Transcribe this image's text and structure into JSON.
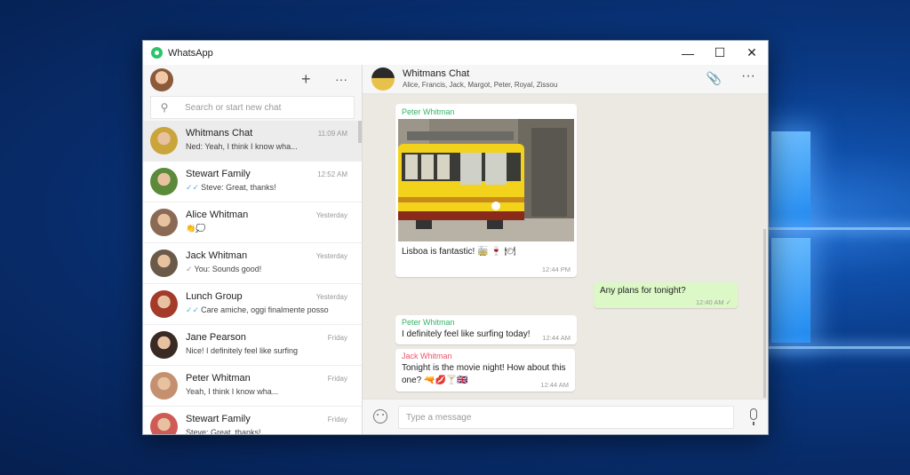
{
  "window": {
    "title": "WhatsApp",
    "controls": [
      "—",
      "☐",
      "✕"
    ]
  },
  "left": {
    "add_icon": "+",
    "more_icon": "···",
    "search_placeholder": "Search or start new chat",
    "chats": [
      {
        "name": "Whitmans Chat",
        "time": "11:09 AM",
        "message": "Ned: Yeah, I think I know wha...",
        "tick": "",
        "avatar_color": "#c9a53c",
        "selected": true
      },
      {
        "name": "Stewart Family",
        "time": "12:52 AM",
        "message": "Steve: Great, thanks!",
        "tick": "✓✓",
        "avatar_color": "#5a8a3a"
      },
      {
        "name": "Alice Whitman",
        "time": "Yesterday",
        "message": "👏💭",
        "tick": "",
        "avatar_color": "#8b6a55"
      },
      {
        "name": "Jack Whitman",
        "time": "Yesterday",
        "message": "You: Sounds good!",
        "tick": "✓",
        "avatar_color": "#6b5a4a"
      },
      {
        "name": "Lunch Group",
        "time": "Yesterday",
        "message": "Care amiche, oggi finalmente posso",
        "tick": "✓✓",
        "avatar_color": "#a33a2a"
      },
      {
        "name": "Jane Pearson",
        "time": "Friday",
        "message": "Nice! I definitely feel like surfing",
        "tick": "",
        "avatar_color": "#3a2a24"
      },
      {
        "name": "Peter Whitman",
        "time": "Friday",
        "message": "Yeah, I think I know wha...",
        "tick": "",
        "avatar_color": "#c49070"
      },
      {
        "name": "Stewart Family",
        "time": "Friday",
        "message": "Steve: Great, thanks!",
        "tick": "",
        "avatar_color": "#d05a55"
      }
    ]
  },
  "right": {
    "group_name": "Whitmans Chat",
    "members": "Alice, Francis, Jack, Margot, Peter, Royal, Zissou",
    "messages": [
      {
        "type": "image",
        "sender": "Peter Whitman",
        "sender_color": "#35b36a",
        "text": "Lisboa is fantastic! 🚋 🍷 🍽",
        "time": "12:44 PM"
      },
      {
        "type": "out",
        "text": "Any plans for tonight?",
        "time": "12:40 AM ✓"
      },
      {
        "type": "in",
        "sender": "Peter Whitman",
        "sender_color": "#35b36a",
        "text": "I definitely feel like surfing today!",
        "time": "12:44 AM"
      },
      {
        "type": "in",
        "sender": "Jack Whitman",
        "sender_color": "#e8566a",
        "text_line1": "Tonight is the movie night! How about this",
        "text_line2": "one? 🔫💋🍸🇬🇧",
        "time": "12:44 AM"
      }
    ],
    "composer_placeholder": "Type a message"
  }
}
